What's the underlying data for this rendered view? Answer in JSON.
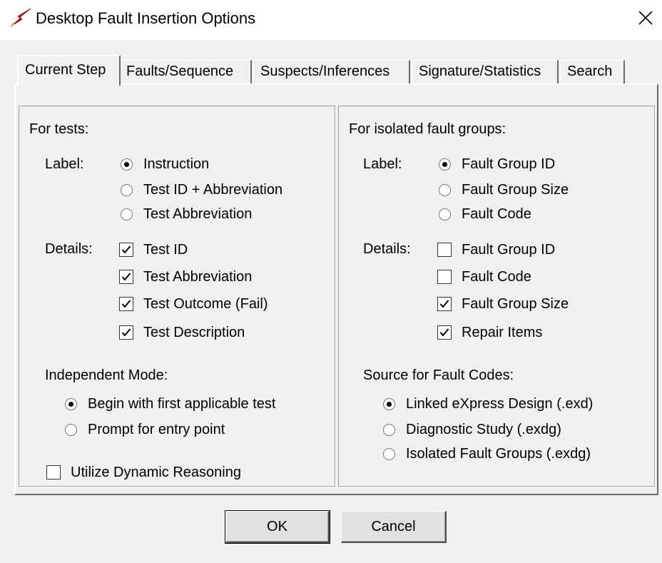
{
  "window": {
    "title": "Desktop Fault Insertion Options"
  },
  "tabs": [
    "Current Step",
    "Faults/Sequence",
    "Suspects/Inferences",
    "Signature/Statistics",
    "Search"
  ],
  "tests": {
    "heading": "For tests:",
    "label_caption": "Label:",
    "label_options": [
      "Instruction",
      "Test ID + Abbreviation",
      "Test Abbreviation"
    ],
    "label_selected": 0,
    "details_caption": "Details:",
    "details": [
      {
        "label": "Test ID",
        "checked": true
      },
      {
        "label": "Test Abbreviation",
        "checked": true
      },
      {
        "label": "Test Outcome (Fail)",
        "checked": true
      },
      {
        "label": "Test Description",
        "checked": true
      }
    ],
    "independent_caption": "Independent Mode:",
    "independent_options": [
      "Begin with first applicable test",
      "Prompt for entry point"
    ],
    "independent_selected": 0,
    "dynamic_reasoning": {
      "label": "Utilize Dynamic Reasoning",
      "checked": false
    }
  },
  "fault_groups": {
    "heading": "For isolated fault groups:",
    "label_caption": "Label:",
    "label_options": [
      "Fault Group ID",
      "Fault Group Size",
      "Fault Code"
    ],
    "label_selected": 0,
    "details_caption": "Details:",
    "details": [
      {
        "label": "Fault Group ID",
        "checked": false
      },
      {
        "label": "Fault Code",
        "checked": false
      },
      {
        "label": "Fault Group Size",
        "checked": true
      },
      {
        "label": "Repair Items",
        "checked": true
      }
    ],
    "source_caption": "Source for Fault Codes:",
    "source_options": [
      "Linked eXpress Design (.exd)",
      "Diagnostic Study (.exdg)",
      "Isolated Fault Groups (.exdg)"
    ],
    "source_selected": 0
  },
  "buttons": {
    "ok": "OK",
    "cancel": "Cancel"
  },
  "icons": {
    "app": "red-lightning-icon",
    "close": "close-icon"
  },
  "colors": {
    "app_icon": "#c0161c"
  }
}
